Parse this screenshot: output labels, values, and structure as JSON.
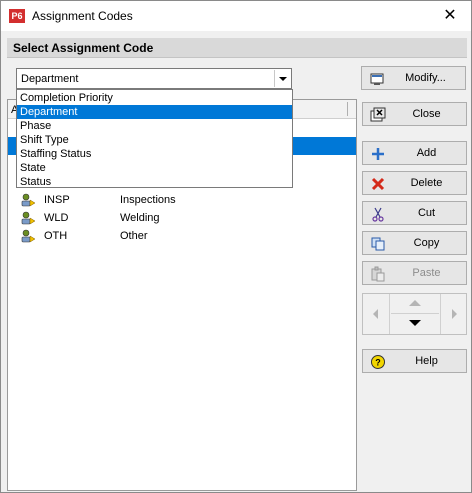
{
  "window": {
    "app_icon_text": "P6",
    "title": "Assignment Codes",
    "close_glyph": "✕"
  },
  "section": {
    "title": "Select Assignment Code"
  },
  "combo": {
    "selected": "Department",
    "options": [
      "Completion Priority",
      "Department",
      "Phase",
      "Shift Type",
      "Staffing Status",
      "State",
      "Status"
    ],
    "highlighted_index": 1
  },
  "list": {
    "header_col_a": "A",
    "rows": [
      {
        "code": "INSP",
        "description": "Inspections",
        "icon": "code-value-icon"
      },
      {
        "code": "WLD",
        "description": "Welding",
        "icon": "code-value-icon"
      },
      {
        "code": "OTH",
        "description": "Other",
        "icon": "code-value-icon"
      }
    ]
  },
  "buttons": {
    "modify": "Modify...",
    "close": "Close",
    "add": "Add",
    "delete": "Delete",
    "cut": "Cut",
    "copy": "Copy",
    "paste": "Paste",
    "help": "Help"
  },
  "colors": {
    "selection": "#0078d7",
    "delete_icon": "#d42a1a",
    "add_icon": "#2a6fc9",
    "help_icon": "#f2d600"
  }
}
